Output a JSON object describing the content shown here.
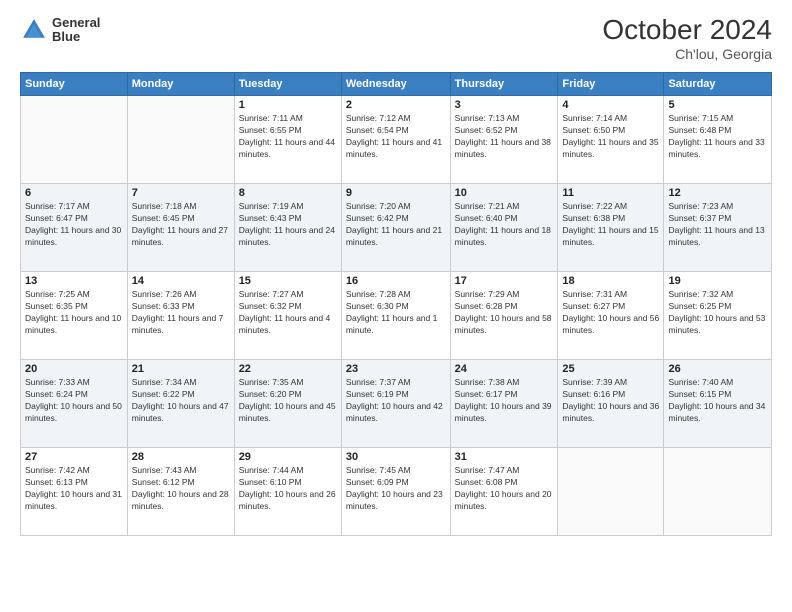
{
  "header": {
    "logo_line1": "General",
    "logo_line2": "Blue",
    "title": "October 2024",
    "subtitle": "Ch'lou, Georgia"
  },
  "weekdays": [
    "Sunday",
    "Monday",
    "Tuesday",
    "Wednesday",
    "Thursday",
    "Friday",
    "Saturday"
  ],
  "weeks": [
    [
      {
        "day": "",
        "sunrise": "",
        "sunset": "",
        "daylight": ""
      },
      {
        "day": "",
        "sunrise": "",
        "sunset": "",
        "daylight": ""
      },
      {
        "day": "1",
        "sunrise": "Sunrise: 7:11 AM",
        "sunset": "Sunset: 6:55 PM",
        "daylight": "Daylight: 11 hours and 44 minutes."
      },
      {
        "day": "2",
        "sunrise": "Sunrise: 7:12 AM",
        "sunset": "Sunset: 6:54 PM",
        "daylight": "Daylight: 11 hours and 41 minutes."
      },
      {
        "day": "3",
        "sunrise": "Sunrise: 7:13 AM",
        "sunset": "Sunset: 6:52 PM",
        "daylight": "Daylight: 11 hours and 38 minutes."
      },
      {
        "day": "4",
        "sunrise": "Sunrise: 7:14 AM",
        "sunset": "Sunset: 6:50 PM",
        "daylight": "Daylight: 11 hours and 35 minutes."
      },
      {
        "day": "5",
        "sunrise": "Sunrise: 7:15 AM",
        "sunset": "Sunset: 6:48 PM",
        "daylight": "Daylight: 11 hours and 33 minutes."
      }
    ],
    [
      {
        "day": "6",
        "sunrise": "Sunrise: 7:17 AM",
        "sunset": "Sunset: 6:47 PM",
        "daylight": "Daylight: 11 hours and 30 minutes."
      },
      {
        "day": "7",
        "sunrise": "Sunrise: 7:18 AM",
        "sunset": "Sunset: 6:45 PM",
        "daylight": "Daylight: 11 hours and 27 minutes."
      },
      {
        "day": "8",
        "sunrise": "Sunrise: 7:19 AM",
        "sunset": "Sunset: 6:43 PM",
        "daylight": "Daylight: 11 hours and 24 minutes."
      },
      {
        "day": "9",
        "sunrise": "Sunrise: 7:20 AM",
        "sunset": "Sunset: 6:42 PM",
        "daylight": "Daylight: 11 hours and 21 minutes."
      },
      {
        "day": "10",
        "sunrise": "Sunrise: 7:21 AM",
        "sunset": "Sunset: 6:40 PM",
        "daylight": "Daylight: 11 hours and 18 minutes."
      },
      {
        "day": "11",
        "sunrise": "Sunrise: 7:22 AM",
        "sunset": "Sunset: 6:38 PM",
        "daylight": "Daylight: 11 hours and 15 minutes."
      },
      {
        "day": "12",
        "sunrise": "Sunrise: 7:23 AM",
        "sunset": "Sunset: 6:37 PM",
        "daylight": "Daylight: 11 hours and 13 minutes."
      }
    ],
    [
      {
        "day": "13",
        "sunrise": "Sunrise: 7:25 AM",
        "sunset": "Sunset: 6:35 PM",
        "daylight": "Daylight: 11 hours and 10 minutes."
      },
      {
        "day": "14",
        "sunrise": "Sunrise: 7:26 AM",
        "sunset": "Sunset: 6:33 PM",
        "daylight": "Daylight: 11 hours and 7 minutes."
      },
      {
        "day": "15",
        "sunrise": "Sunrise: 7:27 AM",
        "sunset": "Sunset: 6:32 PM",
        "daylight": "Daylight: 11 hours and 4 minutes."
      },
      {
        "day": "16",
        "sunrise": "Sunrise: 7:28 AM",
        "sunset": "Sunset: 6:30 PM",
        "daylight": "Daylight: 11 hours and 1 minute."
      },
      {
        "day": "17",
        "sunrise": "Sunrise: 7:29 AM",
        "sunset": "Sunset: 6:28 PM",
        "daylight": "Daylight: 10 hours and 58 minutes."
      },
      {
        "day": "18",
        "sunrise": "Sunrise: 7:31 AM",
        "sunset": "Sunset: 6:27 PM",
        "daylight": "Daylight: 10 hours and 56 minutes."
      },
      {
        "day": "19",
        "sunrise": "Sunrise: 7:32 AM",
        "sunset": "Sunset: 6:25 PM",
        "daylight": "Daylight: 10 hours and 53 minutes."
      }
    ],
    [
      {
        "day": "20",
        "sunrise": "Sunrise: 7:33 AM",
        "sunset": "Sunset: 6:24 PM",
        "daylight": "Daylight: 10 hours and 50 minutes."
      },
      {
        "day": "21",
        "sunrise": "Sunrise: 7:34 AM",
        "sunset": "Sunset: 6:22 PM",
        "daylight": "Daylight: 10 hours and 47 minutes."
      },
      {
        "day": "22",
        "sunrise": "Sunrise: 7:35 AM",
        "sunset": "Sunset: 6:20 PM",
        "daylight": "Daylight: 10 hours and 45 minutes."
      },
      {
        "day": "23",
        "sunrise": "Sunrise: 7:37 AM",
        "sunset": "Sunset: 6:19 PM",
        "daylight": "Daylight: 10 hours and 42 minutes."
      },
      {
        "day": "24",
        "sunrise": "Sunrise: 7:38 AM",
        "sunset": "Sunset: 6:17 PM",
        "daylight": "Daylight: 10 hours and 39 minutes."
      },
      {
        "day": "25",
        "sunrise": "Sunrise: 7:39 AM",
        "sunset": "Sunset: 6:16 PM",
        "daylight": "Daylight: 10 hours and 36 minutes."
      },
      {
        "day": "26",
        "sunrise": "Sunrise: 7:40 AM",
        "sunset": "Sunset: 6:15 PM",
        "daylight": "Daylight: 10 hours and 34 minutes."
      }
    ],
    [
      {
        "day": "27",
        "sunrise": "Sunrise: 7:42 AM",
        "sunset": "Sunset: 6:13 PM",
        "daylight": "Daylight: 10 hours and 31 minutes."
      },
      {
        "day": "28",
        "sunrise": "Sunrise: 7:43 AM",
        "sunset": "Sunset: 6:12 PM",
        "daylight": "Daylight: 10 hours and 28 minutes."
      },
      {
        "day": "29",
        "sunrise": "Sunrise: 7:44 AM",
        "sunset": "Sunset: 6:10 PM",
        "daylight": "Daylight: 10 hours and 26 minutes."
      },
      {
        "day": "30",
        "sunrise": "Sunrise: 7:45 AM",
        "sunset": "Sunset: 6:09 PM",
        "daylight": "Daylight: 10 hours and 23 minutes."
      },
      {
        "day": "31",
        "sunrise": "Sunrise: 7:47 AM",
        "sunset": "Sunset: 6:08 PM",
        "daylight": "Daylight: 10 hours and 20 minutes."
      },
      {
        "day": "",
        "sunrise": "",
        "sunset": "",
        "daylight": ""
      },
      {
        "day": "",
        "sunrise": "",
        "sunset": "",
        "daylight": ""
      }
    ]
  ]
}
